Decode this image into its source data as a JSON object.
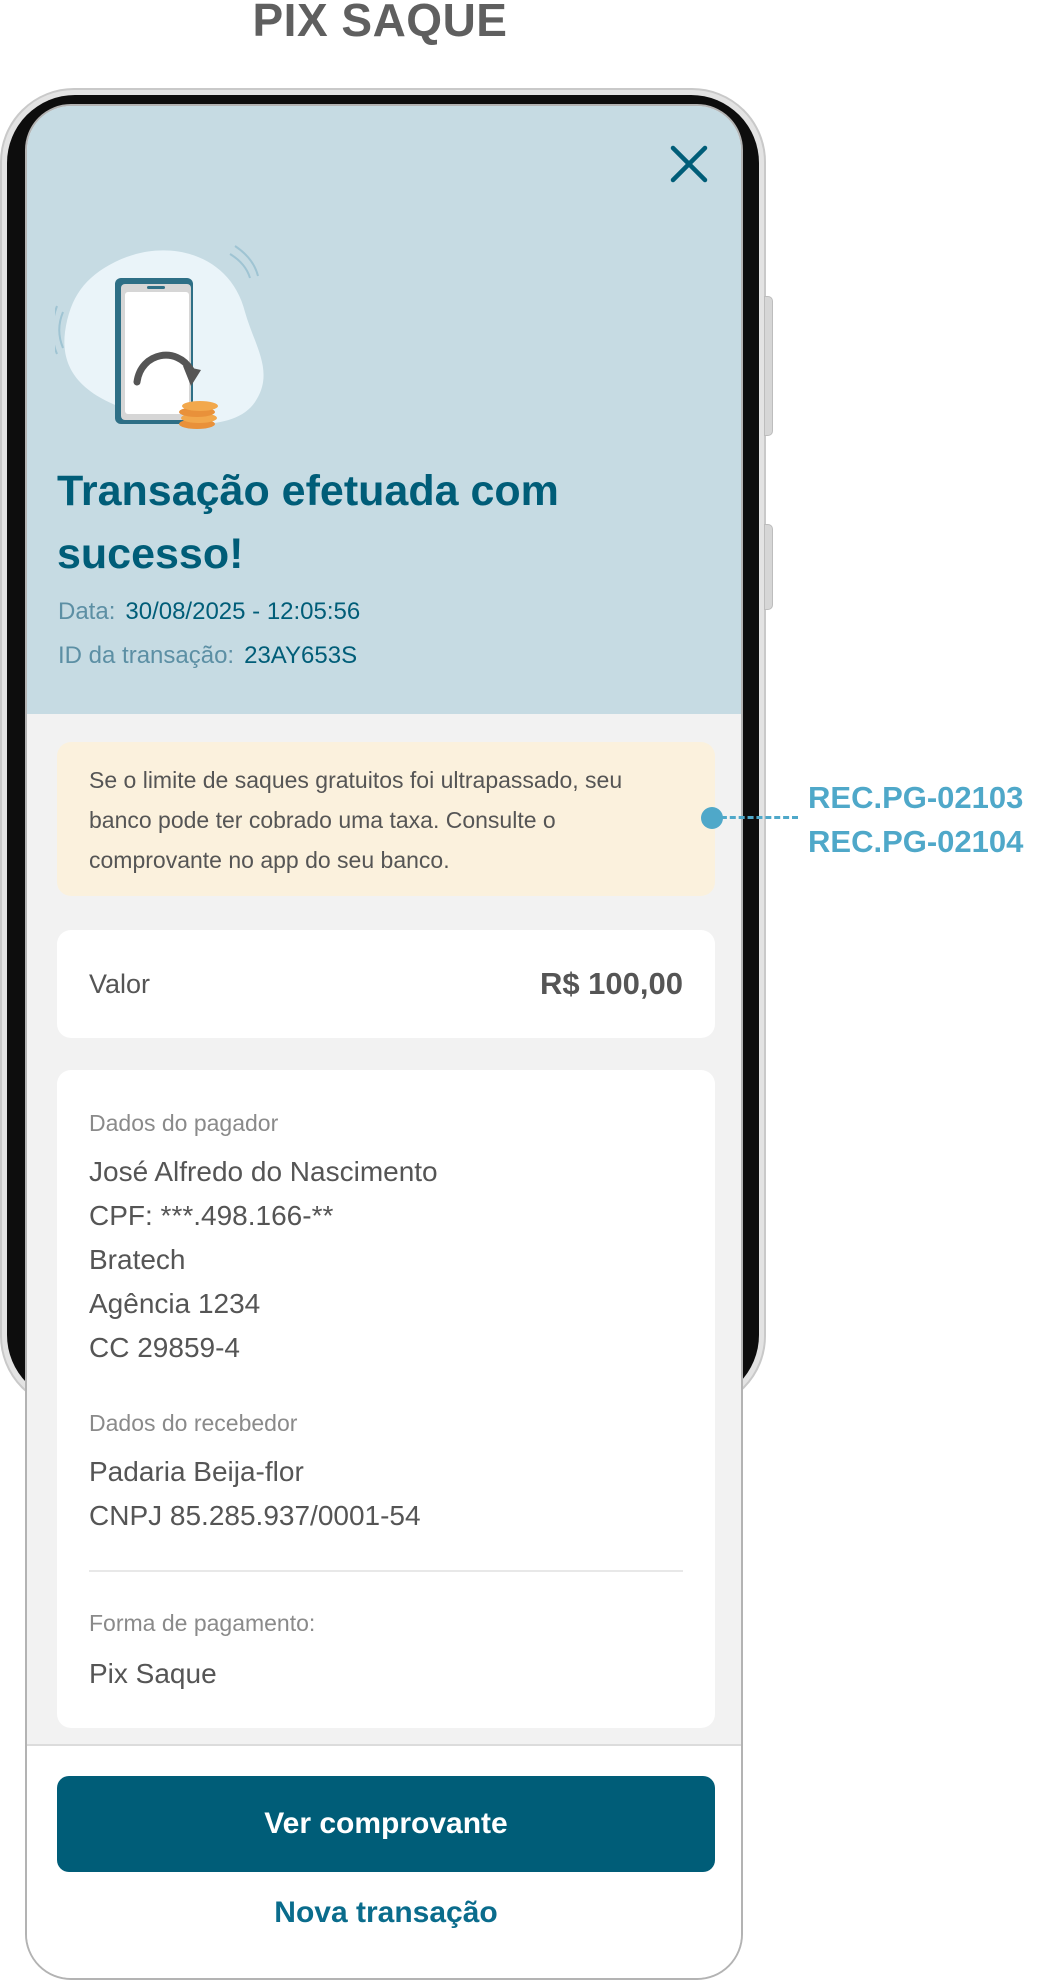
{
  "page_title": "PIX SAQUE",
  "close_icon": "close-icon",
  "illustration_icon": "phone-withdraw-coins-icon",
  "success": {
    "title": "Transação efetuada com sucesso!",
    "date_label": "Data:",
    "date_value": "30/08/2025 - 12:05:56",
    "id_label": "ID da transação:",
    "id_value": "23AY653S"
  },
  "notice": {
    "text": "Se o limite de saques gratuitos foi ultrapassado, seu banco pode ter cobrado uma taxa. Consulte o comprovante no app do seu banco."
  },
  "value": {
    "label": "Valor",
    "amount": "R$ 100,00"
  },
  "payer": {
    "label": "Dados do pagador",
    "lines": [
      "José Alfredo do Nascimento",
      "CPF: ***.498.166-**",
      "Bratech",
      "Agência 1234",
      "CC 29859-4"
    ]
  },
  "receiver": {
    "label": "Dados do recebedor",
    "lines": [
      "Padaria Beija-flor",
      "CNPJ 85.285.937/0001-54"
    ]
  },
  "payment": {
    "label": "Forma de pagamento:",
    "value": "Pix Saque"
  },
  "actions": {
    "primary": "Ver comprovante",
    "secondary": "Nova transação"
  },
  "annotation": {
    "codes": [
      "REC.PG-02103",
      "REC.PG-02104"
    ]
  },
  "colors": {
    "brand": "#005d78",
    "hero_bg": "#c6dbe3",
    "notice_bg": "#fbf1dd",
    "annotation": "#4fa8c9"
  }
}
